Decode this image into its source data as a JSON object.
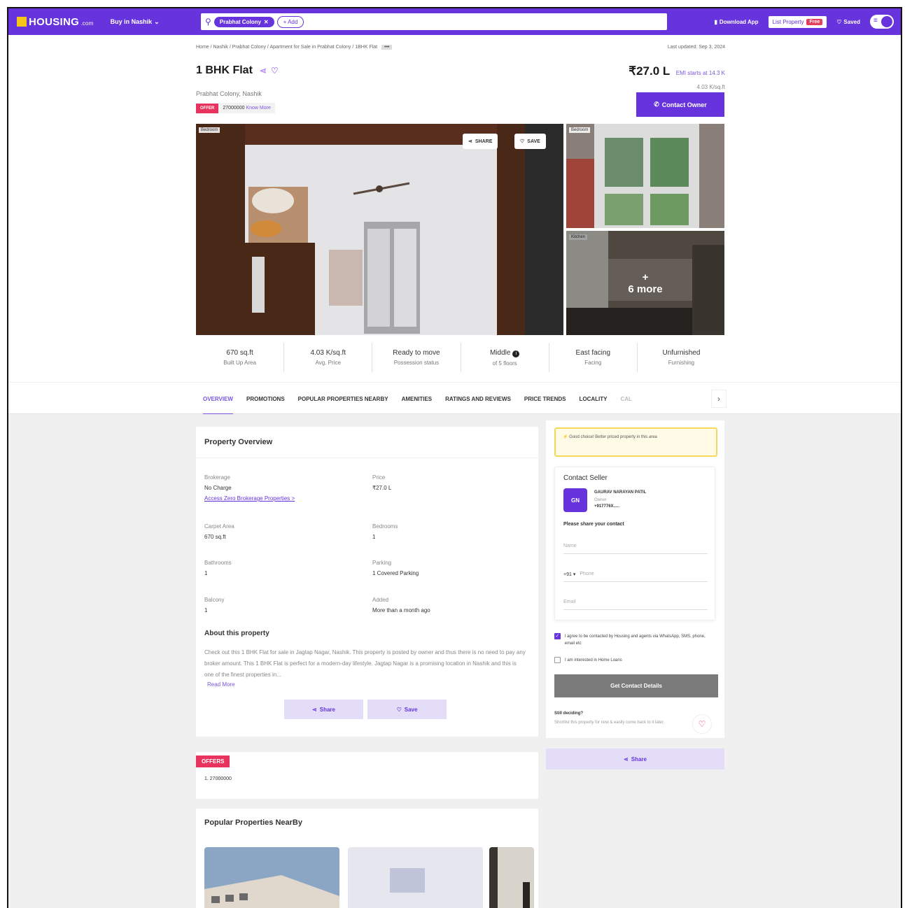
{
  "nav": {
    "logo_text": "HOUSING",
    "logo_suffix": ".com",
    "buy_menu": "Buy in Nashik",
    "search_chip": "Prabhat Colony",
    "add_chip": "+ Add",
    "download_app": "Download App",
    "list_property": "List Property",
    "free_badge": "Free",
    "saved": "Saved"
  },
  "breadcrumb": {
    "path": "Home / Nashik / Prabhat Colony / Apartment for Sale in Prabhat Colony / 1BHK Flat",
    "more": "•••",
    "last_updated": "Last updated: Sep 3, 2024"
  },
  "listing": {
    "title": "1 BHK Flat",
    "price": "₹27.0 L",
    "emi": "EMI starts at 14.3 K",
    "per_sqft": "4.03 K/sq.ft",
    "locality": "Prabhat Colony, Nashik",
    "offer_tag": "OFFER",
    "offer_text": "27000000",
    "offer_link": "Know More",
    "contact_owner": "Contact Owner"
  },
  "gallery": {
    "main_label": "Bedroom",
    "side1_label": "Bedroom",
    "side2_label": "Kitchen",
    "share_btn": "SHARE",
    "save_btn": "SAVE",
    "more_plus": "+",
    "more_text": "6 more"
  },
  "stats": [
    {
      "value": "670 sq.ft",
      "label": "Built Up Area"
    },
    {
      "value": "4.03 K/sq.ft",
      "label": "Avg. Price"
    },
    {
      "value": "Ready to move",
      "label": "Possession status"
    },
    {
      "value": "Middle",
      "label": "of 5 floors"
    },
    {
      "value": "East facing",
      "label": "Facing"
    },
    {
      "value": "Unfurnished",
      "label": "Furnishing"
    }
  ],
  "tabs": [
    "OVERVIEW",
    "PROMOTIONS",
    "POPULAR PROPERTIES NEARBY",
    "AMENITIES",
    "RATINGS AND REVIEWS",
    "PRICE TRENDS",
    "LOCALITY",
    "CAL"
  ],
  "overview": {
    "heading": "Property Overview",
    "brokerage_k": "Brokerage",
    "brokerage_v": "No Charge",
    "brokerage_link": "Access Zero Brokerage Properties >",
    "price_k": "Price",
    "price_v": "₹27.0 L",
    "carpet_k": "Carpet Area",
    "carpet_v": "670 sq.ft",
    "bedrooms_k": "Bedrooms",
    "bedrooms_v": "1",
    "bathrooms_k": "Bathrooms",
    "bathrooms_v": "1",
    "parking_k": "Parking",
    "parking_v": "1 Covered Parking",
    "balcony_k": "Balcony",
    "balcony_v": "1",
    "added_k": "Added",
    "added_v": "More than a month ago",
    "about_heading": "About this property",
    "about_text": "Check out this 1 BHK Flat for sale in Jagtap Nagar, Nashik. This property is posted by owner and thus there is no need to pay any broker amount. This 1 BHK Flat is perfect for a modern-day lifestyle. Jagtap Nagar is a promising location in Nashik and this is one of the finest properties in...",
    "read_more": "Read More",
    "share_btn": "Share",
    "save_btn": "Save"
  },
  "offers_card": {
    "tag": "OFFERS",
    "text": "1. 27000000"
  },
  "popular": {
    "heading": "Popular Properties NearBy"
  },
  "sidebar": {
    "good_choice": "Good choice! Better priced property in this area",
    "contact_heading": "Contact Seller",
    "seller_initials": "GN",
    "seller_name": "GAURAV NARAYAN PATIL",
    "seller_role": "Owner",
    "seller_phone": "+917776X.....",
    "share_contact": "Please share your contact",
    "name_placeholder": "Name",
    "country_code": "+91",
    "phone_placeholder": "Phone",
    "email_placeholder": "Email",
    "agree_text": "I agree to be contacted by Housing and agents via WhatsApp, SMS, phone, email etc",
    "home_loans_text": "I am interested in Home Loans",
    "get_details": "Get Contact Details",
    "still_deciding": "Still deciding?",
    "still_sub": "Shortlist this property for now & easily come back to it later.",
    "share_bar": "Share"
  }
}
